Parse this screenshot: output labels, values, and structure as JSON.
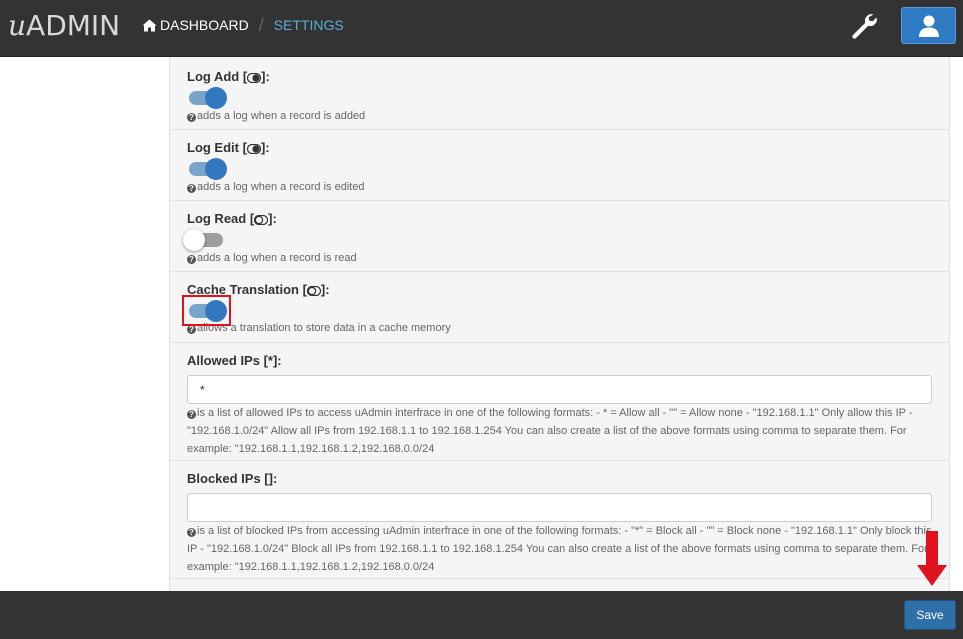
{
  "header": {
    "logo_u": "u",
    "logo_text": "ADMIN",
    "breadcrumb": {
      "dashboard": "DASHBOARD",
      "separator": "/",
      "settings": "SETTINGS"
    },
    "wrench_icon": "wrench-icon",
    "user_icon": "user-icon"
  },
  "settings": [
    {
      "label": "Log Add [",
      "label_suffix": "]:",
      "state": "on",
      "help": "adds a log when a record is added"
    },
    {
      "label": "Log Edit [",
      "label_suffix": "]:",
      "state": "on",
      "help": "adds a log when a record is edited"
    },
    {
      "label": "Log Read [",
      "label_suffix": "]:",
      "state": "off",
      "help": "adds a log when a record is read"
    },
    {
      "label": "Cache Translation [",
      "label_suffix": "]:",
      "state": "on",
      "help": "allows a translation to store data in a cache memory"
    }
  ],
  "allowed_ips": {
    "label": "Allowed IPs [*]:",
    "value": "*",
    "help": "is a list of allowed IPs to access uAdmin interfrace in one of the following formats: - * = Allow all - \"\" = Allow none - \"192.168.1.1\" Only allow this IP - \"192.168.1.0/24\" Allow all IPs from 192.168.1.1 to 192.168.1.254 You can also create a list of the above formats using comma to separate them. For example: \"192.168.1.1,192.168.1.2,192.168.0.0/24"
  },
  "blocked_ips": {
    "label": "Blocked IPs []:",
    "value": "",
    "help": "is a list of blocked IPs from accessing uAdmin interfrace in one of the following formats: - \"*\" = Block all - \"\" = Block none - \"192.168.1.1\" Only block this IP - \"192.168.1.0/24\" Block all IPs from 192.168.1.1 to 192.168.1.254 You can also create a list of the above formats using comma to separate them. For example: \"192.168.1.1,192.168.1.2,192.168.0.0/24"
  },
  "footer": {
    "save_label": "Save"
  },
  "colors": {
    "topbar": "#333333",
    "accent": "#3278c0",
    "highlight": "#e0121d"
  }
}
